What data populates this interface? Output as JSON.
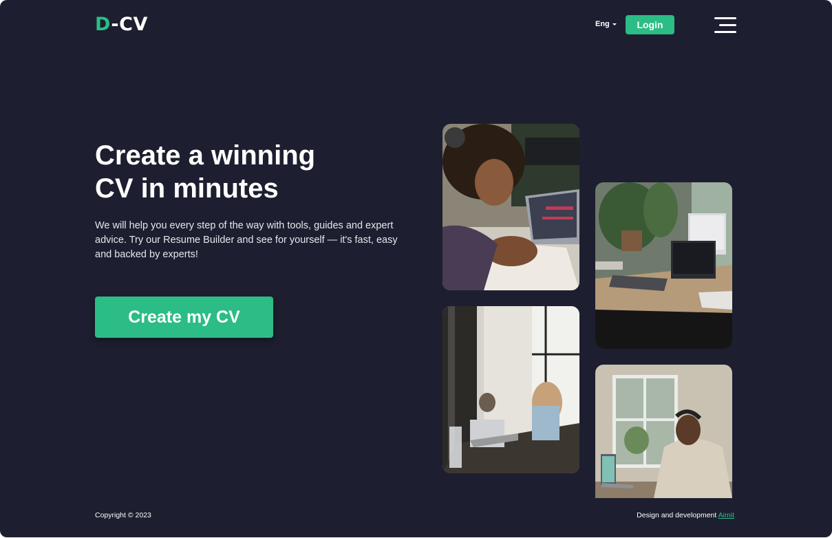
{
  "header": {
    "logo": {
      "accent": "D",
      "rest": "-CV"
    },
    "language": "Eng",
    "login_label": "Login",
    "menu_icon": "hamburger-menu-icon"
  },
  "hero": {
    "title_line1": "Create a winning",
    "title_line2": "CV in minutes",
    "subtitle": "We will help you every step of the way with tools, guides and expert advice. Try our Resume Builder and see for yourself — it's fast, easy and backed by experts!",
    "cta_label": "Create my CV"
  },
  "footer": {
    "copyright": "Copyright © 2023",
    "credit_text": "Design and development",
    "credit_link": "Aimit"
  },
  "colors": {
    "background": "#1d1f30",
    "accent": "#2bbd85",
    "text": "#ffffff"
  }
}
